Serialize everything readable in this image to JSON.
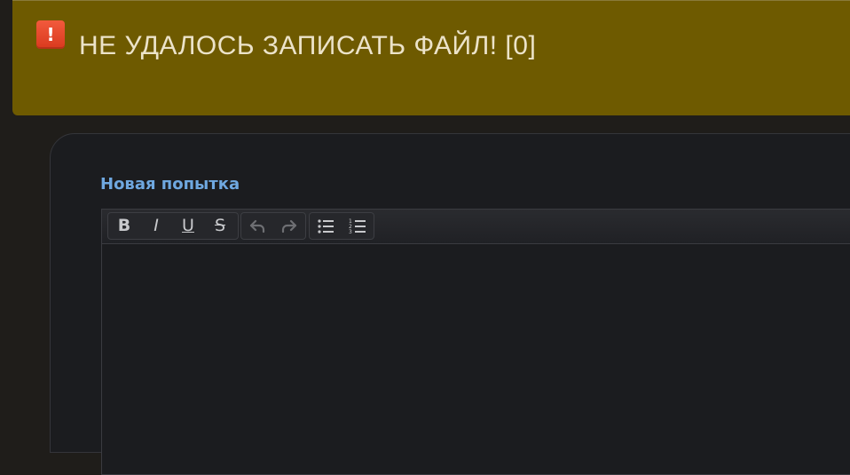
{
  "alert": {
    "icon": "exclamation-icon",
    "icon_glyph": "!",
    "message": "НЕ УДАЛОСЬ ЗАПИСАТЬ ФАЙЛ! [0]",
    "background_color": "#6e5a00",
    "text_color": "#ece3c9",
    "icon_color": "#e84a2c"
  },
  "form": {
    "label": "Новая попытка",
    "label_color": "#6fa8e0",
    "editor_value": ""
  },
  "toolbar": {
    "groups": [
      {
        "name": "formatting",
        "buttons": [
          {
            "name": "bold",
            "icon": "bold-icon",
            "glyph": "B"
          },
          {
            "name": "italic",
            "icon": "italic-icon",
            "glyph": "I"
          },
          {
            "name": "underline",
            "icon": "underline-icon",
            "glyph": "U"
          },
          {
            "name": "strikethrough",
            "icon": "strikethrough-icon",
            "glyph": "S"
          }
        ]
      },
      {
        "name": "history",
        "buttons": [
          {
            "name": "undo",
            "icon": "undo-icon",
            "disabled": true
          },
          {
            "name": "redo",
            "icon": "redo-icon",
            "disabled": true
          }
        ]
      },
      {
        "name": "lists",
        "buttons": [
          {
            "name": "bullet-list",
            "icon": "bullet-list-icon"
          },
          {
            "name": "numbered-list",
            "icon": "numbered-list-icon"
          }
        ]
      }
    ]
  }
}
